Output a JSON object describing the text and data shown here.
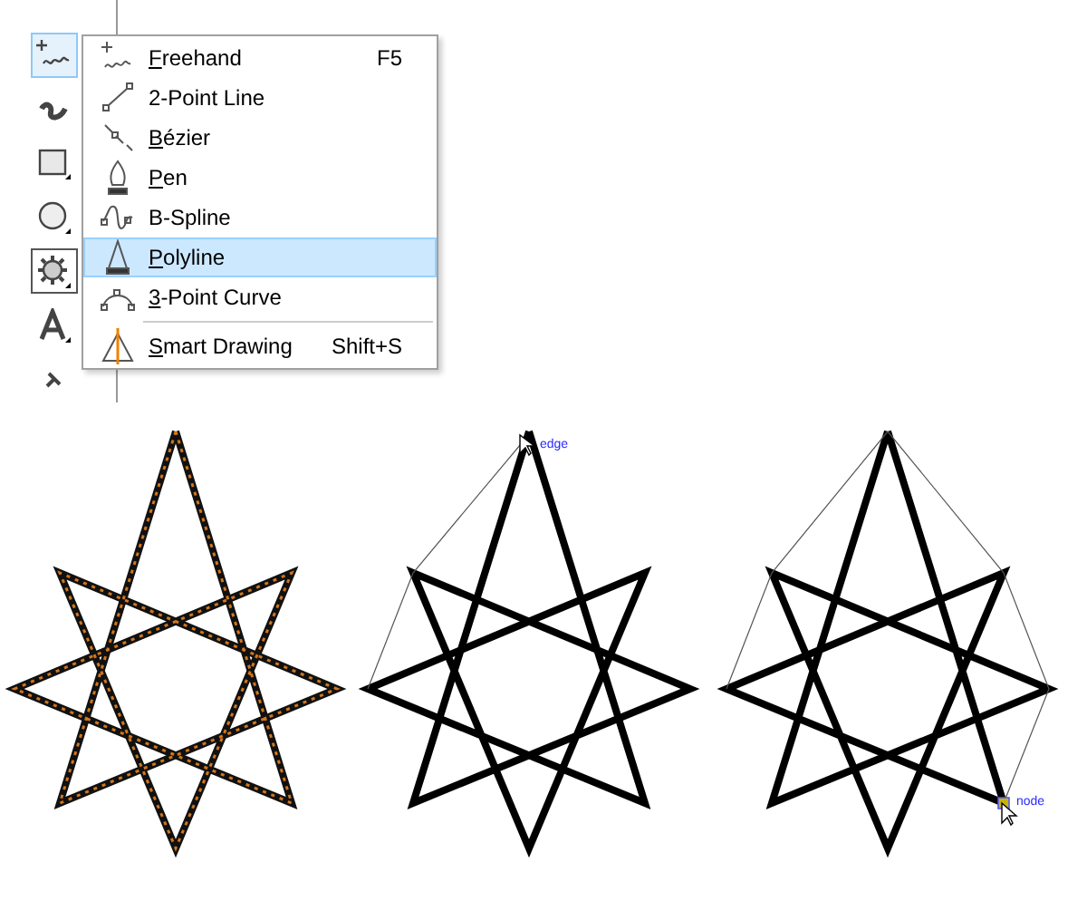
{
  "toolbox": {
    "tools": [
      {
        "kind": "freehand",
        "selected": true
      },
      {
        "kind": "artistic",
        "selected": false
      },
      {
        "kind": "rectangle",
        "selected": false
      },
      {
        "kind": "ellipse",
        "selected": false
      },
      {
        "kind": "polygon",
        "selected": true
      },
      {
        "kind": "text",
        "selected": false
      },
      {
        "kind": "pin",
        "selected": false
      }
    ]
  },
  "menu": {
    "items": [
      {
        "kind": "freehand",
        "label": "Freehand",
        "mnemonic": true,
        "shortcut": "F5",
        "selected": false,
        "separator_before": false
      },
      {
        "kind": "line",
        "label": "2-Point Line",
        "mnemonic": false,
        "selected": false,
        "separator_before": false
      },
      {
        "kind": "bezier",
        "label": "Bézier",
        "mnemonic": true,
        "selected": false,
        "separator_before": false
      },
      {
        "kind": "pen",
        "label": "Pen",
        "mnemonic": true,
        "selected": false,
        "separator_before": false
      },
      {
        "kind": "bspline",
        "label": "B-Spline",
        "mnemonic": false,
        "selected": false,
        "separator_before": false
      },
      {
        "kind": "polyline",
        "label": "Polyline",
        "mnemonic": true,
        "selected": true,
        "separator_before": false
      },
      {
        "kind": "curve",
        "label": "3-Point Curve",
        "mnemonic": true,
        "selected": false,
        "separator_before": false
      },
      {
        "kind": "smart",
        "label": "Smart Drawing",
        "mnemonic": true,
        "shortcut": "Shift+S",
        "selected": false,
        "separator_before": true
      }
    ]
  },
  "drawings": [
    {
      "kind": "outlined"
    },
    {
      "kind": "edge-snap",
      "snap_label": "edge"
    },
    {
      "kind": "node-snap",
      "snap_label": "node"
    }
  ]
}
